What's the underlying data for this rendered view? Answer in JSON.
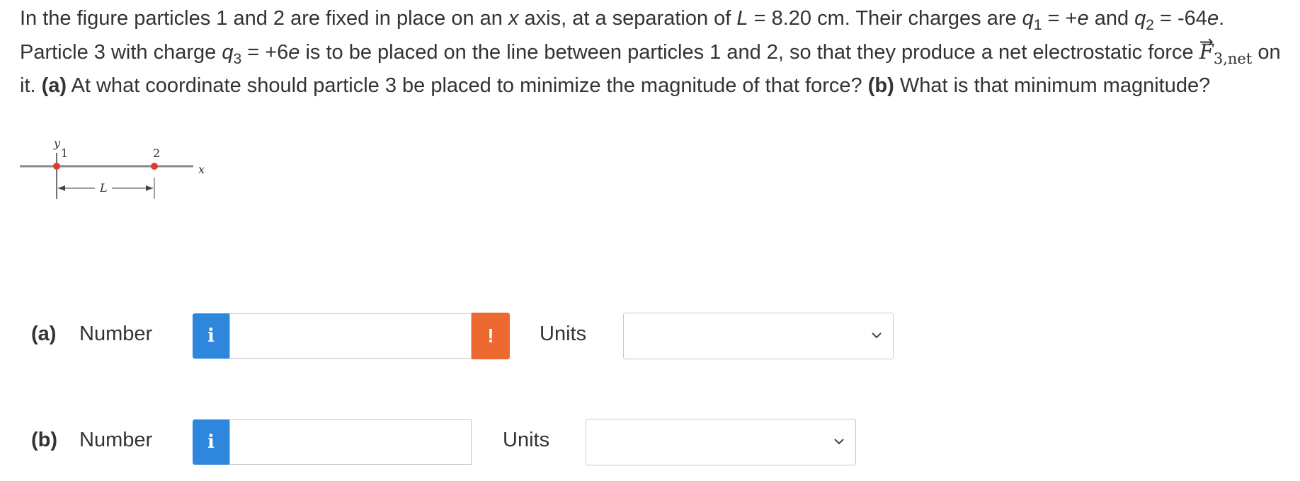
{
  "question": {
    "intro": "In the figure particles 1 and 2 are fixed in place on an ",
    "x_var": "x",
    "axis_sep": " axis, at a separation of ",
    "L_var": "L",
    "L_value": " = 8.20 cm. Their charges are ",
    "q1_var": "q",
    "q1_sub": "1",
    "q1_value": " = +",
    "e1": "e",
    "and_text": " and ",
    "q2_var": "q",
    "q2_sub": "2",
    "q2_value": " = -64",
    "e2": "e",
    "period1": ".",
    "line2_start": " Particle 3 with charge ",
    "q3_var": "q",
    "q3_sub": "3",
    "q3_value": " = +6",
    "e3": "e",
    "line2_rest": " is to be placed on the line between particles 1 and 2, so that they produce a net electrostatic force ",
    "F_symbol": "F",
    "F_arrow": "→",
    "F_sub": "3,net",
    "on_it": " on it. ",
    "part_a_tag": "(a)",
    "part_a_text": " At what coordinate should particle 3 be placed to minimize the magnitude of that force? ",
    "part_b_tag": "(b)",
    "part_b_text": " What is that minimum magnitude?"
  },
  "figure": {
    "y_label": "y",
    "x_label": "x",
    "p1_label": "1",
    "p2_label": "2",
    "L_label": "L",
    "particle_color": "#e03a2f"
  },
  "answers": {
    "a": {
      "label": "(a)",
      "number_label": "Number",
      "info_icon": "i",
      "value": "",
      "warning_icon": "!",
      "units_label": "Units",
      "units_selected": ""
    },
    "b": {
      "label": "(b)",
      "number_label": "Number",
      "info_icon": "i",
      "value": "",
      "units_label": "Units",
      "units_selected": ""
    }
  },
  "colors": {
    "info_blue": "#2f86dd",
    "warning_orange": "#ec6a2f"
  }
}
